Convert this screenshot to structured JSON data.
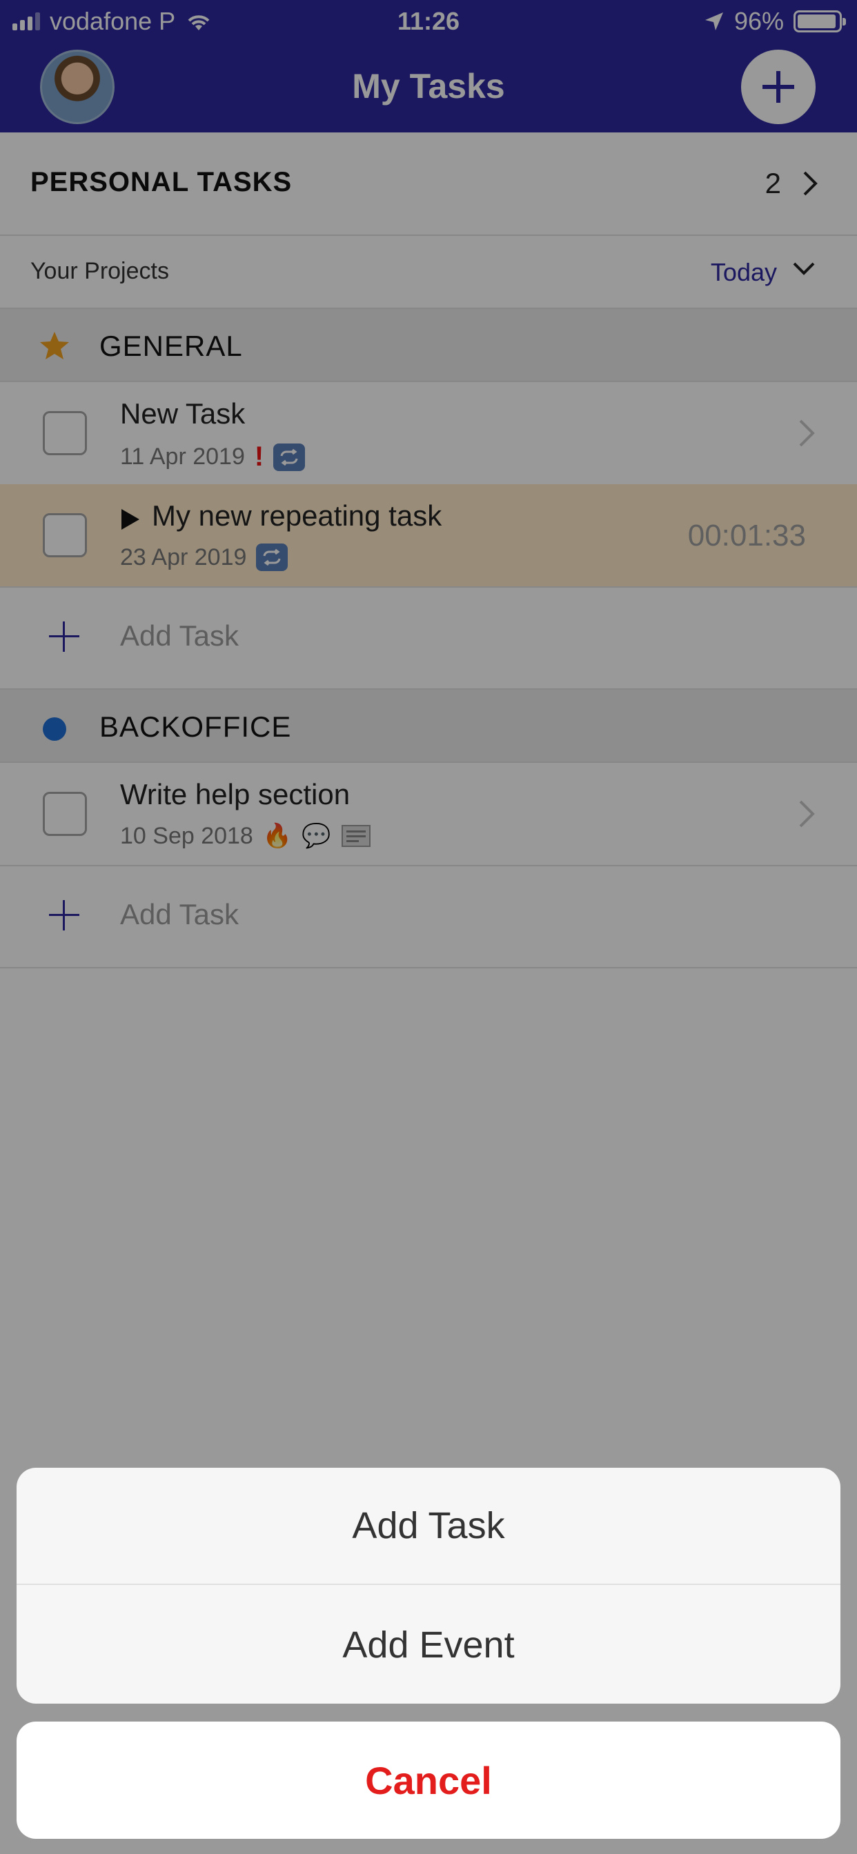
{
  "status_bar": {
    "carrier": "vodafone P",
    "time": "11:26",
    "battery": "96%"
  },
  "header": {
    "title": "My Tasks"
  },
  "personal": {
    "label": "PERSONAL TASKS",
    "count": "2"
  },
  "projects": {
    "label": "Your Projects",
    "filter": "Today"
  },
  "groups": [
    {
      "name": "GENERAL",
      "icon": "star-icon",
      "tasks": [
        {
          "title": "New Task",
          "date": "11 Apr 2019",
          "flags": [
            "important",
            "repeat"
          ]
        },
        {
          "title": "My new repeating task",
          "date": "23 Apr 2019",
          "timer": "00:01:33",
          "playing": true,
          "flags": [
            "repeat"
          ]
        }
      ],
      "add_label": "Add Task"
    },
    {
      "name": "BACKOFFICE",
      "icon": "blue-dot",
      "tasks": [
        {
          "title": "Write help section",
          "date": "10 Sep 2018",
          "flags": [
            "fire",
            "comment",
            "note"
          ]
        }
      ],
      "add_label": "Add Task"
    }
  ],
  "action_sheet": {
    "options": [
      "Add Task",
      "Add Event"
    ],
    "cancel": "Cancel"
  },
  "colors": {
    "primary": "#2d28a0",
    "highlight": "#ffeccc",
    "destructive": "#e31c1c"
  }
}
